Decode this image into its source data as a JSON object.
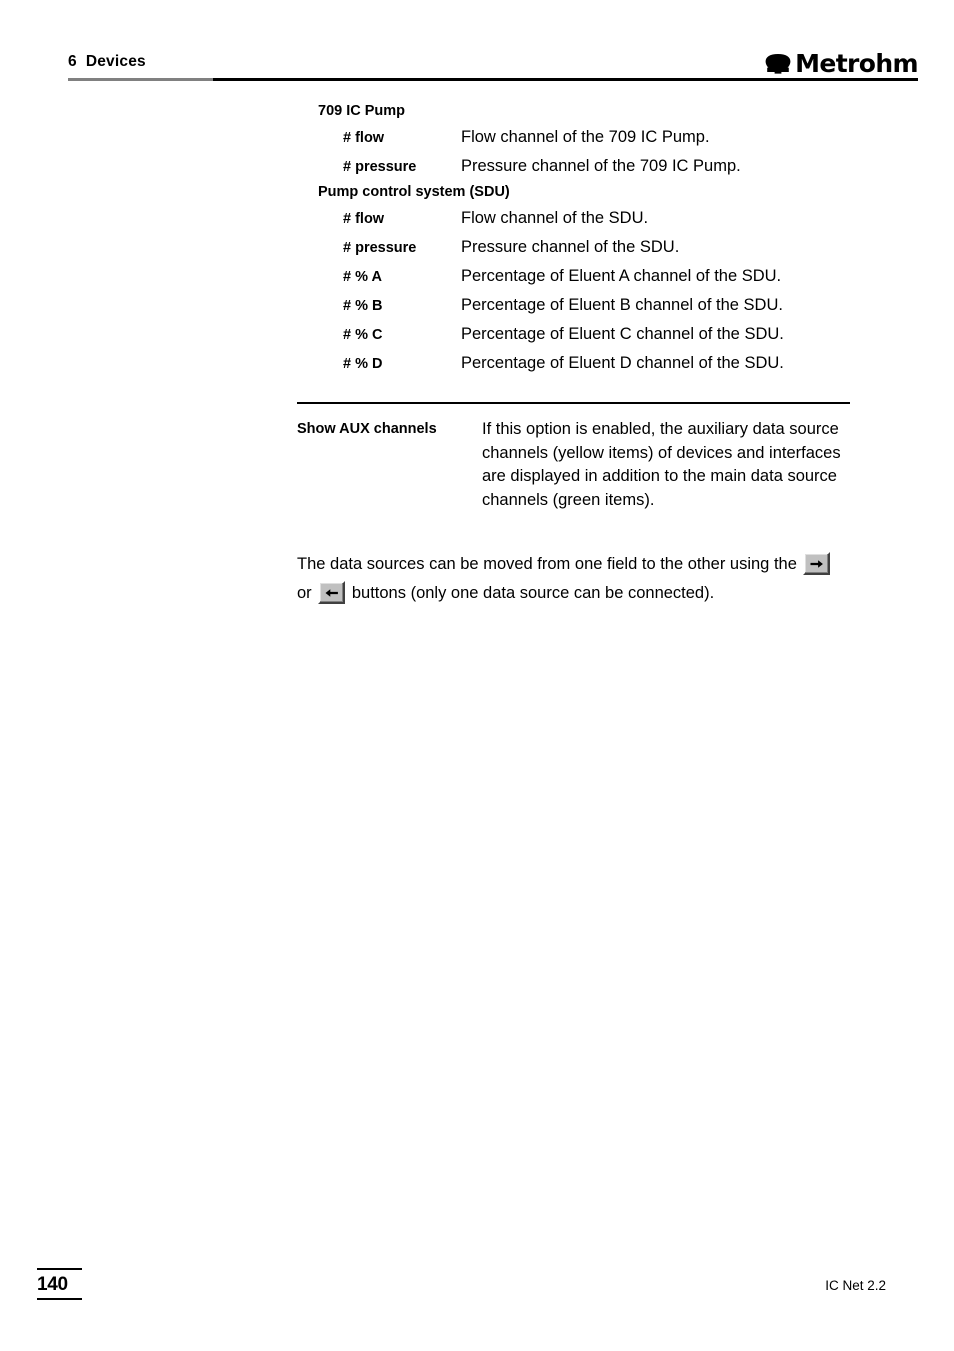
{
  "header": {
    "chapter_number": "6",
    "chapter_title": "Devices",
    "brand_name": "Metrohm",
    "brand_mark_icon": "omega-logo-icon"
  },
  "content": {
    "groups": [
      {
        "heading": "709 IC Pump",
        "rows": [
          {
            "term": "# flow",
            "desc": "Flow channel of the 709 IC Pump."
          },
          {
            "term": "# pressure",
            "desc": "Pressure channel of the 709 IC Pump."
          }
        ]
      },
      {
        "heading": "Pump control system (SDU)",
        "rows": [
          {
            "term": "# flow",
            "desc": "Flow channel of the SDU."
          },
          {
            "term": "# pressure",
            "desc": "Pressure channel of the SDU."
          },
          {
            "term": "# % A",
            "desc": "Percentage of Eluent A channel of the SDU."
          },
          {
            "term": "# % B",
            "desc": "Percentage of Eluent B channel of the SDU."
          },
          {
            "term": "# % C",
            "desc": "Percentage of Eluent C channel of the SDU."
          },
          {
            "term": "# % D",
            "desc": "Percentage of Eluent D channel of the SDU."
          }
        ]
      }
    ],
    "aux": {
      "term": "Show AUX channels",
      "description": "If this option is enabled, the auxiliary data source channels (yellow items) of devices and interfaces are displayed in addition to the main data source channels (green items)."
    },
    "paragraph": {
      "part1": "The data sources can be moved from one field to the other using the",
      "conjunction": "or",
      "part2": "buttons (only one data source can be connected).",
      "button_right_icon": "arrow-right-icon",
      "button_left_icon": "arrow-left-icon"
    }
  },
  "footer": {
    "page_number": "140",
    "product": "IC Net 2.2"
  }
}
